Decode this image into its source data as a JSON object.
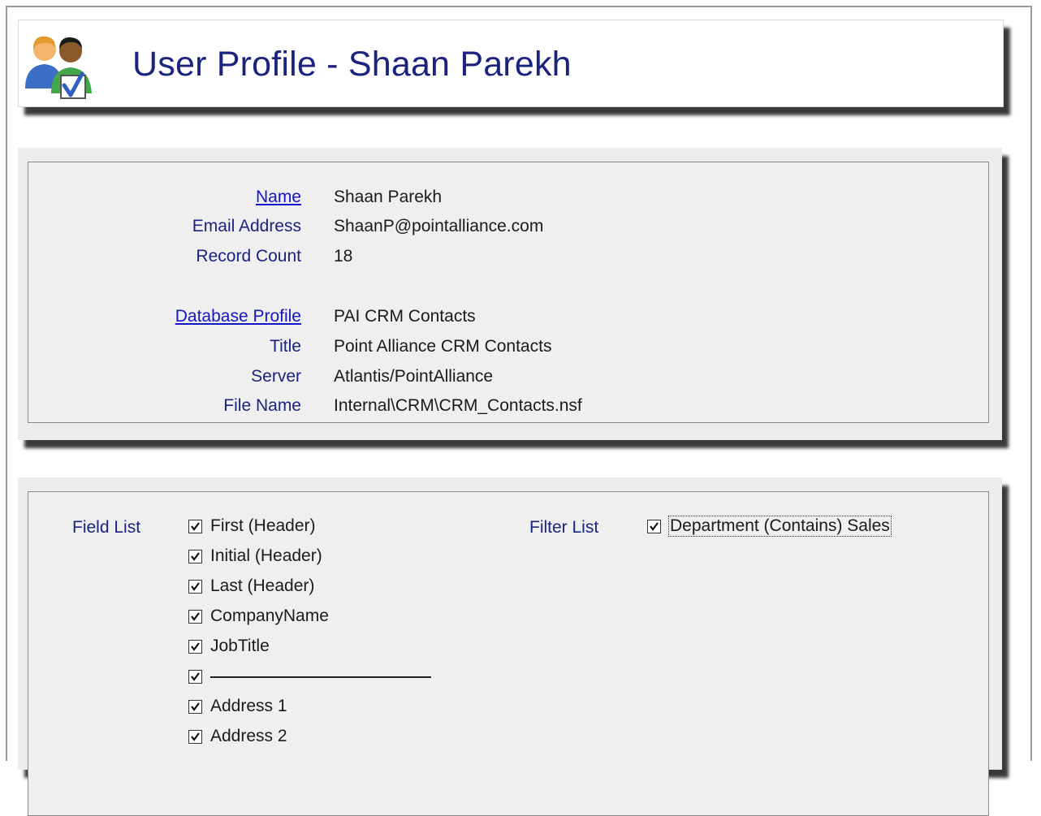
{
  "header": {
    "title": "User Profile - Shaan Parekh",
    "icon": "users-check-icon"
  },
  "profile": {
    "rows": [
      {
        "label": "Name",
        "value": "Shaan Parekh",
        "link": true
      },
      {
        "label": "Email Address",
        "value": "ShaanP@pointalliance.com",
        "link": false
      },
      {
        "label": "Record Count",
        "value": "18",
        "link": false
      },
      {
        "label": "Database Profile",
        "value": "PAI CRM Contacts",
        "link": true
      },
      {
        "label": "Title",
        "value": "Point Alliance CRM Contacts",
        "link": false
      },
      {
        "label": "Server",
        "value": "Atlantis/PointAlliance",
        "link": false
      },
      {
        "label": "File Name",
        "value": "Internal\\CRM\\CRM_Contacts.nsf",
        "link": false
      }
    ]
  },
  "field_list": {
    "label": "Field List",
    "items": [
      {
        "label": "First (Header)",
        "checked": true
      },
      {
        "label": "Initial (Header)",
        "checked": true
      },
      {
        "label": "Last (Header)",
        "checked": true
      },
      {
        "label": "CompanyName",
        "checked": true
      },
      {
        "label": "JobTitle",
        "checked": true
      },
      {
        "label": "",
        "checked": true,
        "separator": true
      },
      {
        "label": "Address 1",
        "checked": true
      },
      {
        "label": "Address 2",
        "checked": true
      }
    ]
  },
  "filter_list": {
    "label": "Filter List",
    "items": [
      {
        "label": "Department (Contains) Sales",
        "checked": true
      }
    ]
  },
  "colors": {
    "label_text": "#1a237e",
    "link_text": "#1414c8",
    "panel_bg": "#ececec"
  }
}
